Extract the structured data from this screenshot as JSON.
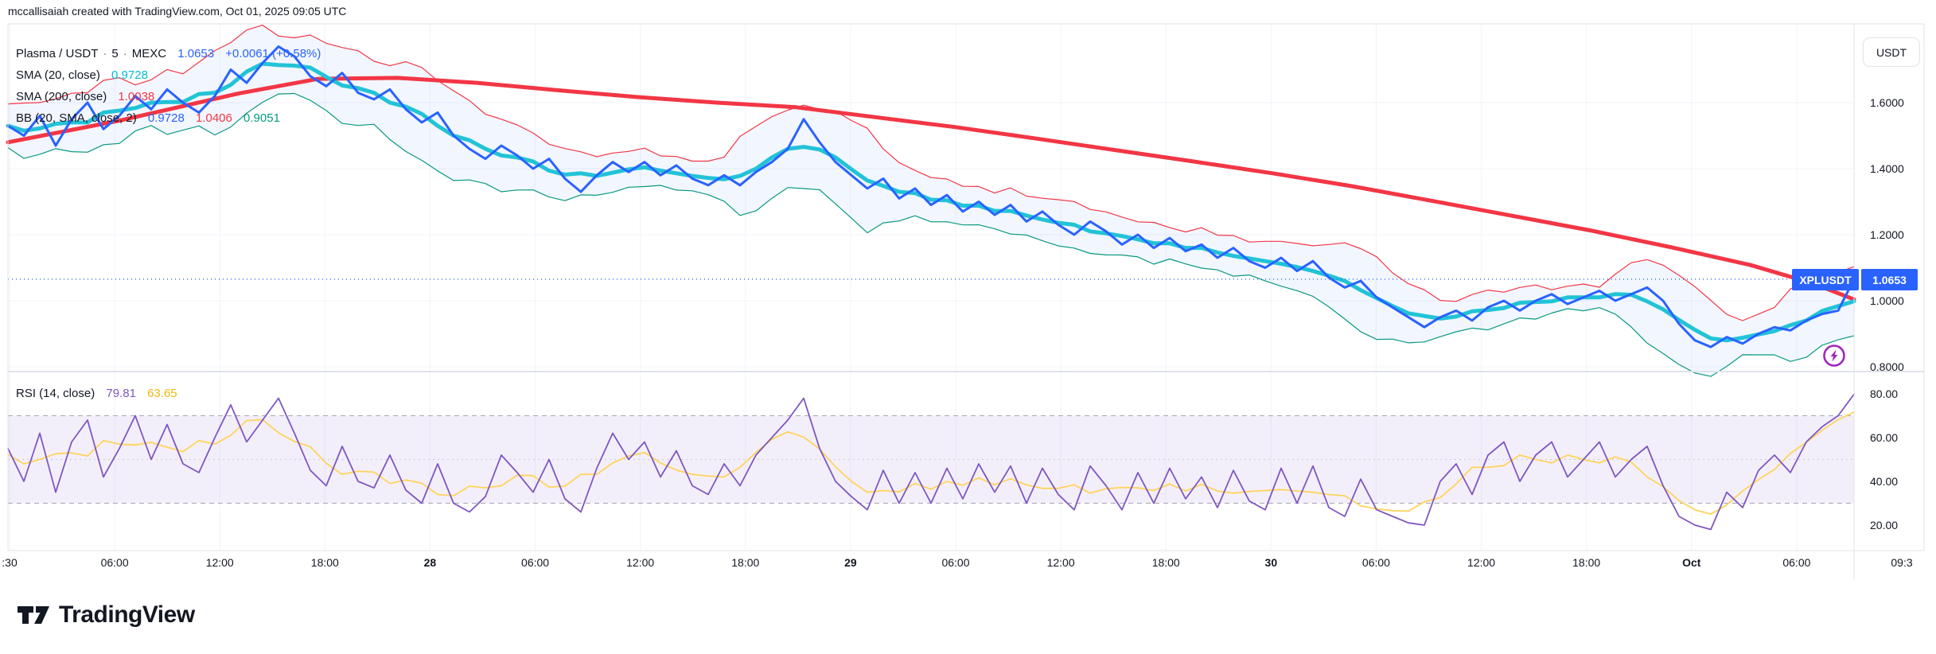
{
  "attribution": "mccallisaiah created with TradingView.com, Oct 01, 2025 09:05 UTC",
  "legend": {
    "symbol": "Plasma / USDT",
    "interval": "5",
    "exchange": "MEXC",
    "sep": "·",
    "price": "1.0653",
    "change": "+0.0061 (+0.58%)",
    "sma20_label": "SMA (20, close)",
    "sma20_value": "0.9728",
    "sma200_label": "SMA (200, close)",
    "sma200_value": "1.0038",
    "bb_label": "BB (20, SMA, close, 2)",
    "bb_basis": "0.9728",
    "bb_upper": "1.0406",
    "bb_lower": "0.9051",
    "rsi_label": "RSI (14, close)",
    "rsi_value": "79.81",
    "rsi_ma_value": "63.65"
  },
  "price_scale": {
    "currency_button": "USDT",
    "tick_labels": [
      "1.6000",
      "1.4000",
      "1.2000",
      "1.0000",
      "0.8000"
    ],
    "price_label_symbol": "XPLUSDT",
    "price_label_value": "1.0653"
  },
  "rsi_scale": {
    "tick_labels": [
      "80.00",
      "60.00",
      "40.00",
      "20.00"
    ]
  },
  "time_axis": {
    "labels": [
      {
        "t": ":30",
        "b": false
      },
      {
        "t": "06:00",
        "b": false
      },
      {
        "t": "12:00",
        "b": false
      },
      {
        "t": "18:00",
        "b": false
      },
      {
        "t": "28",
        "b": true
      },
      {
        "t": "06:00",
        "b": false
      },
      {
        "t": "12:00",
        "b": false
      },
      {
        "t": "18:00",
        "b": false
      },
      {
        "t": "29",
        "b": true
      },
      {
        "t": "06:00",
        "b": false
      },
      {
        "t": "12:00",
        "b": false
      },
      {
        "t": "18:00",
        "b": false
      },
      {
        "t": "30",
        "b": true
      },
      {
        "t": "06:00",
        "b": false
      },
      {
        "t": "12:00",
        "b": false
      },
      {
        "t": "18:00",
        "b": false
      },
      {
        "t": "Oct",
        "b": true
      },
      {
        "t": "06:00",
        "b": false
      },
      {
        "t": "09:3",
        "b": false
      }
    ]
  },
  "logo_text": "TradingView",
  "colors": {
    "accent_blue": "#2962FF",
    "cyan_text": "#00BCD4",
    "cyan_line": "#22C3D6",
    "red": "#F23645",
    "green": "#089981",
    "purple": "#7E57C2",
    "yellow_text": "#F0B90B",
    "yellow_line": "#FFD35C",
    "text": "#131722",
    "grid": "#F0F3FA",
    "border": "#E0E3EB",
    "band_fill": "rgba(136,98,204,0.10)",
    "bb_fill": "rgba(41,98,255,0.06)",
    "dashed_gray": "#A6A9B3"
  },
  "chart_data": {
    "type": "line",
    "title": "Plasma / USDT · 5 · MEXC",
    "ylabel": "USDT",
    "x_labels": [
      ":30",
      "06:00",
      "12:00",
      "18:00",
      "28",
      "06:00",
      "12:00",
      "18:00",
      "29",
      "06:00",
      "12:00",
      "18:00",
      "30",
      "06:00",
      "12:00",
      "18:00",
      "Oct",
      "06:00",
      "09:3"
    ],
    "panes": [
      {
        "name": "price",
        "ylim": [
          0.7855,
          1.8386
        ],
        "yticks": [
          1.6,
          1.4,
          1.2,
          1.0,
          0.8
        ],
        "last_price": 1.0653,
        "series": [
          {
            "name": "price",
            "color": "#2962FF",
            "width": 3,
            "values": [
              1.53,
              1.5,
              1.56,
              1.47,
              1.55,
              1.6,
              1.52,
              1.56,
              1.62,
              1.58,
              1.64,
              1.6,
              1.57,
              1.62,
              1.7,
              1.66,
              1.72,
              1.77,
              1.74,
              1.68,
              1.65,
              1.69,
              1.63,
              1.61,
              1.64,
              1.58,
              1.54,
              1.57,
              1.5,
              1.46,
              1.43,
              1.47,
              1.44,
              1.4,
              1.43,
              1.37,
              1.33,
              1.38,
              1.42,
              1.39,
              1.42,
              1.38,
              1.41,
              1.37,
              1.35,
              1.38,
              1.35,
              1.39,
              1.42,
              1.46,
              1.55,
              1.48,
              1.42,
              1.38,
              1.34,
              1.37,
              1.31,
              1.34,
              1.29,
              1.32,
              1.27,
              1.3,
              1.26,
              1.29,
              1.24,
              1.27,
              1.23,
              1.2,
              1.24,
              1.21,
              1.17,
              1.2,
              1.16,
              1.19,
              1.15,
              1.17,
              1.13,
              1.16,
              1.12,
              1.1,
              1.13,
              1.09,
              1.12,
              1.07,
              1.04,
              1.06,
              1.01,
              0.98,
              0.95,
              0.92,
              0.95,
              0.97,
              0.94,
              0.98,
              1.0,
              0.97,
              1.0,
              1.02,
              0.99,
              1.01,
              1.03,
              1.0,
              1.02,
              1.04,
              1.0,
              0.93,
              0.88,
              0.86,
              0.89,
              0.87,
              0.9,
              0.92,
              0.91,
              0.94,
              0.96,
              0.97,
              1.0653
            ]
          },
          {
            "name": "SMA 20",
            "color": "#22C3D6",
            "width": 5,
            "derived": "sma",
            "window": 5,
            "of": "price"
          },
          {
            "name": "SMA 200",
            "color": "#F23645",
            "width": 5,
            "anchors": [
              [
                0,
                1.48
              ],
              [
                0.06,
                1.545
              ],
              [
                0.125,
                1.628
              ],
              [
                0.168,
                1.672
              ],
              [
                0.211,
                1.675
              ],
              [
                0.254,
                1.66
              ],
              [
                0.297,
                1.638
              ],
              [
                0.341,
                1.617
              ],
              [
                0.384,
                1.6
              ],
              [
                0.427,
                1.586
              ],
              [
                0.47,
                1.556
              ],
              [
                0.513,
                1.526
              ],
              [
                0.556,
                1.492
              ],
              [
                0.599,
                1.457
              ],
              [
                0.642,
                1.422
              ],
              [
                0.685,
                1.386
              ],
              [
                0.728,
                1.347
              ],
              [
                0.772,
                1.302
              ],
              [
                0.815,
                1.257
              ],
              [
                0.858,
                1.212
              ],
              [
                0.901,
                1.162
              ],
              [
                0.944,
                1.108
              ],
              [
                0.978,
                1.052
              ],
              [
                1,
                1.004
              ]
            ]
          },
          {
            "name": "BB upper",
            "color": "#F23645",
            "width": 1.2,
            "derived": "bb_upper",
            "window": 9,
            "mult": 2,
            "of": "price"
          },
          {
            "name": "BB lower",
            "color": "#089981",
            "width": 1.2,
            "derived": "bb_lower",
            "window": 9,
            "mult": 2,
            "of": "price"
          }
        ]
      },
      {
        "name": "rsi",
        "ylim": [
          9.8,
          89.1
        ],
        "yticks": [
          80,
          60,
          40,
          20
        ],
        "band": [
          30,
          70
        ],
        "band_mid": 50,
        "series": [
          {
            "name": "RSI",
            "color": "#7E57C2",
            "width": 1.8,
            "values": [
              55,
              40,
              62,
              35,
              58,
              68,
              42,
              55,
              70,
              50,
              66,
              48,
              44,
              60,
              75,
              58,
              68,
              78,
              62,
              45,
              38,
              56,
              40,
              37,
              52,
              36,
              30,
              48,
              30,
              26,
              33,
              52,
              44,
              35,
              50,
              32,
              26,
              46,
              62,
              50,
              58,
              42,
              54,
              38,
              34,
              48,
              38,
              52,
              60,
              68,
              78,
              55,
              40,
              33,
              27,
              45,
              30,
              44,
              30,
              46,
              32,
              48,
              35,
              47,
              30,
              46,
              34,
              27,
              47,
              38,
              27,
              44,
              30,
              46,
              32,
              42,
              28,
              45,
              31,
              27,
              46,
              30,
              47,
              28,
              24,
              41,
              27,
              24,
              21,
              20,
              40,
              48,
              34,
              52,
              58,
              40,
              52,
              58,
              42,
              50,
              58,
              42,
              50,
              56,
              38,
              24,
              20,
              18,
              35,
              28,
              45,
              52,
              44,
              58,
              65,
              70,
              79.81
            ]
          },
          {
            "name": "RSI-based MA",
            "color": "#FFD35C",
            "width": 1.8,
            "derived": "sma",
            "window": 5,
            "of": "RSI"
          }
        ]
      }
    ]
  }
}
